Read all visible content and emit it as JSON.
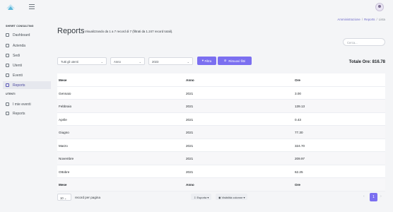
{
  "sidebar": {
    "section1": "SHRIRT CONSULTING",
    "items": [
      {
        "label": "Dashboard",
        "icon": "dashboard-icon"
      },
      {
        "label": "Azienda",
        "icon": "building-icon"
      },
      {
        "label": "Sedi",
        "icon": "location-icon"
      },
      {
        "label": "Utenti",
        "icon": "users-icon"
      },
      {
        "label": "Eventi",
        "icon": "calendar-icon"
      },
      {
        "label": "Reports",
        "icon": "reports-icon",
        "active": true
      }
    ],
    "section2": "UTENTI",
    "items2": [
      {
        "label": "I mie eventi",
        "icon": "calendar-icon"
      },
      {
        "label": "Reports",
        "icon": "reports-icon"
      }
    ]
  },
  "breadcrumb": {
    "a": "Amministrazione",
    "b": "Reports",
    "c": "Lista"
  },
  "page": {
    "title": "Reports",
    "subtitle": "Visualizzando da 1 a 7 record di 7 (filtrati da 1.247 record totali).",
    "search_placeholder": "Cerca..."
  },
  "filters": {
    "user": "Tutti gli utenti",
    "period": "Anno",
    "year": "2023",
    "filter_label": "Filtra",
    "remove_label": "Rimuovi filtri"
  },
  "total_label": "Totale Ore: 816.78",
  "table": {
    "headers": [
      "Mese",
      "Anno",
      "Ore"
    ],
    "rows": [
      [
        "Gennaio",
        "2021",
        "3.00"
      ],
      [
        "Febbraio",
        "2021",
        "139.13"
      ],
      [
        "Aprile",
        "2021",
        "0.43"
      ],
      [
        "Giugno",
        "2021",
        "77.30"
      ],
      [
        "Marzo",
        "2021",
        "324.70"
      ],
      [
        "Novembre",
        "2021",
        "209.97"
      ],
      [
        "Ottobre",
        "2021",
        "62.25"
      ]
    ]
  },
  "footer": {
    "per_page_value": "10",
    "per_page_label": "record per pagina",
    "export_label": "Esporta",
    "columns_label": "Visibilità colonne",
    "current_page": "1"
  },
  "colors": {
    "accent": "#7b6ff0"
  }
}
